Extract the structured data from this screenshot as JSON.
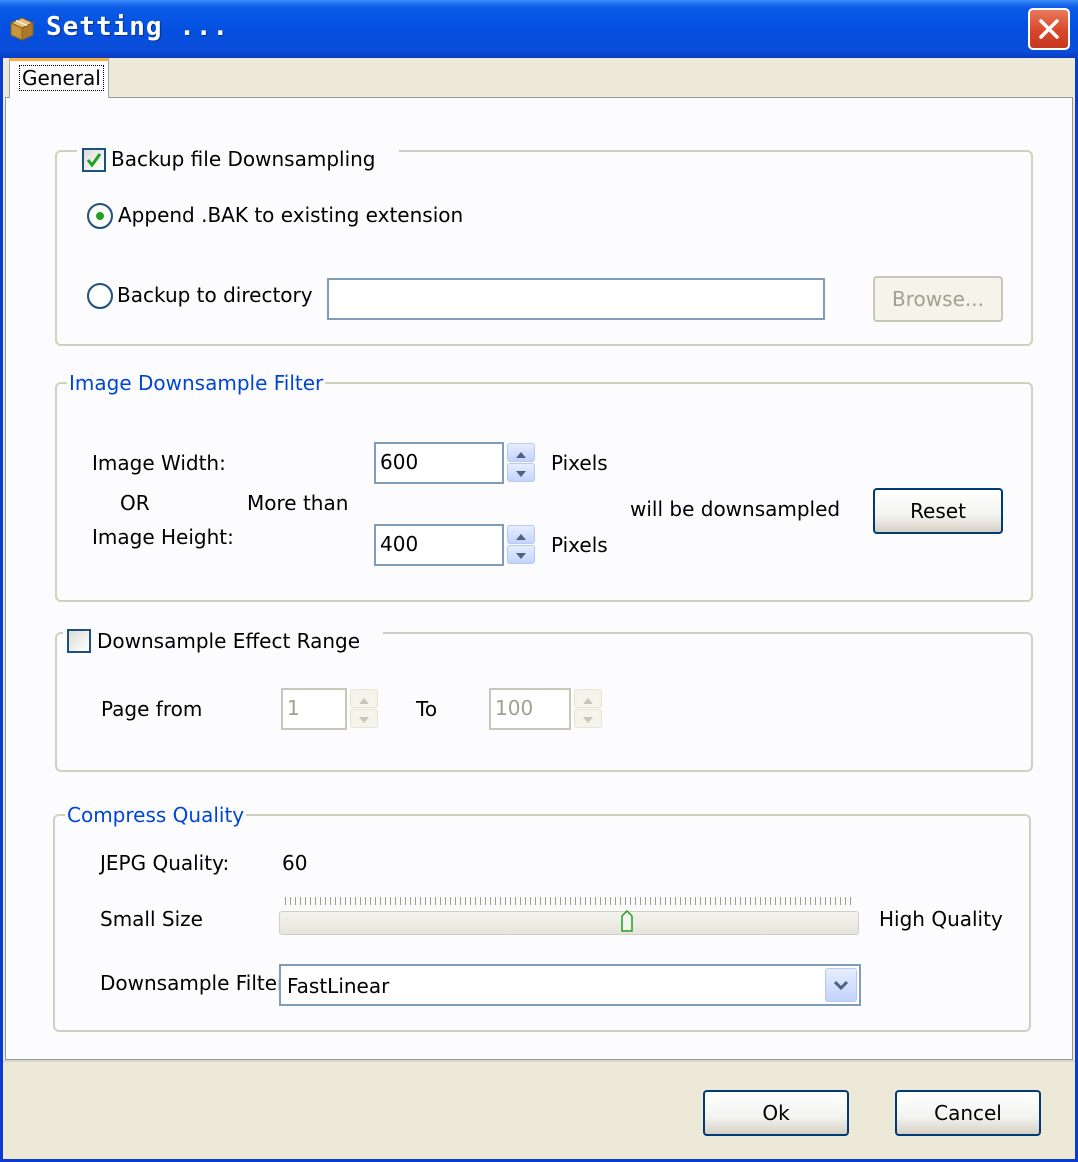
{
  "window": {
    "title": "Setting ...",
    "icon": "package-icon"
  },
  "tabs": [
    {
      "label": "General",
      "selected": true
    }
  ],
  "backup": {
    "checkbox_label": "Backup file Downsampling",
    "checked": true,
    "append_label": "Append .BAK to existing extension",
    "append_selected": true,
    "directory_label": "Backup to directory",
    "directory_value": "",
    "browse_label": "Browse..."
  },
  "filter": {
    "group_label": "Image Downsample Filter",
    "width_label": "Image Width:",
    "or_label": "OR",
    "more_than_label": "More than",
    "height_label": "Image Height:",
    "width_value": "600",
    "height_value": "400",
    "pixels_label": "Pixels",
    "will_label": "will be downsampled",
    "reset_label": "Reset"
  },
  "range": {
    "checkbox_label": "Downsample Effect Range",
    "checked": false,
    "page_from_label": "Page from",
    "from_value": "1",
    "to_label": "To",
    "to_value": "100"
  },
  "quality": {
    "group_label": "Compress Quality",
    "jpeg_label": "JEPG Quality:",
    "jpeg_value": "60",
    "small_label": "Small Size",
    "high_label": "High Quality",
    "slider_fraction": 0.6,
    "filter_label": "Downsample Filter",
    "filter_value": "FastLinear"
  },
  "buttons": {
    "ok_label": "Ok",
    "cancel_label": "Cancel"
  },
  "colors": {
    "title_bar": "#0450E0",
    "group_label": "#0046D5",
    "check_mark": "#21A121",
    "close_button": "#D9472B"
  }
}
